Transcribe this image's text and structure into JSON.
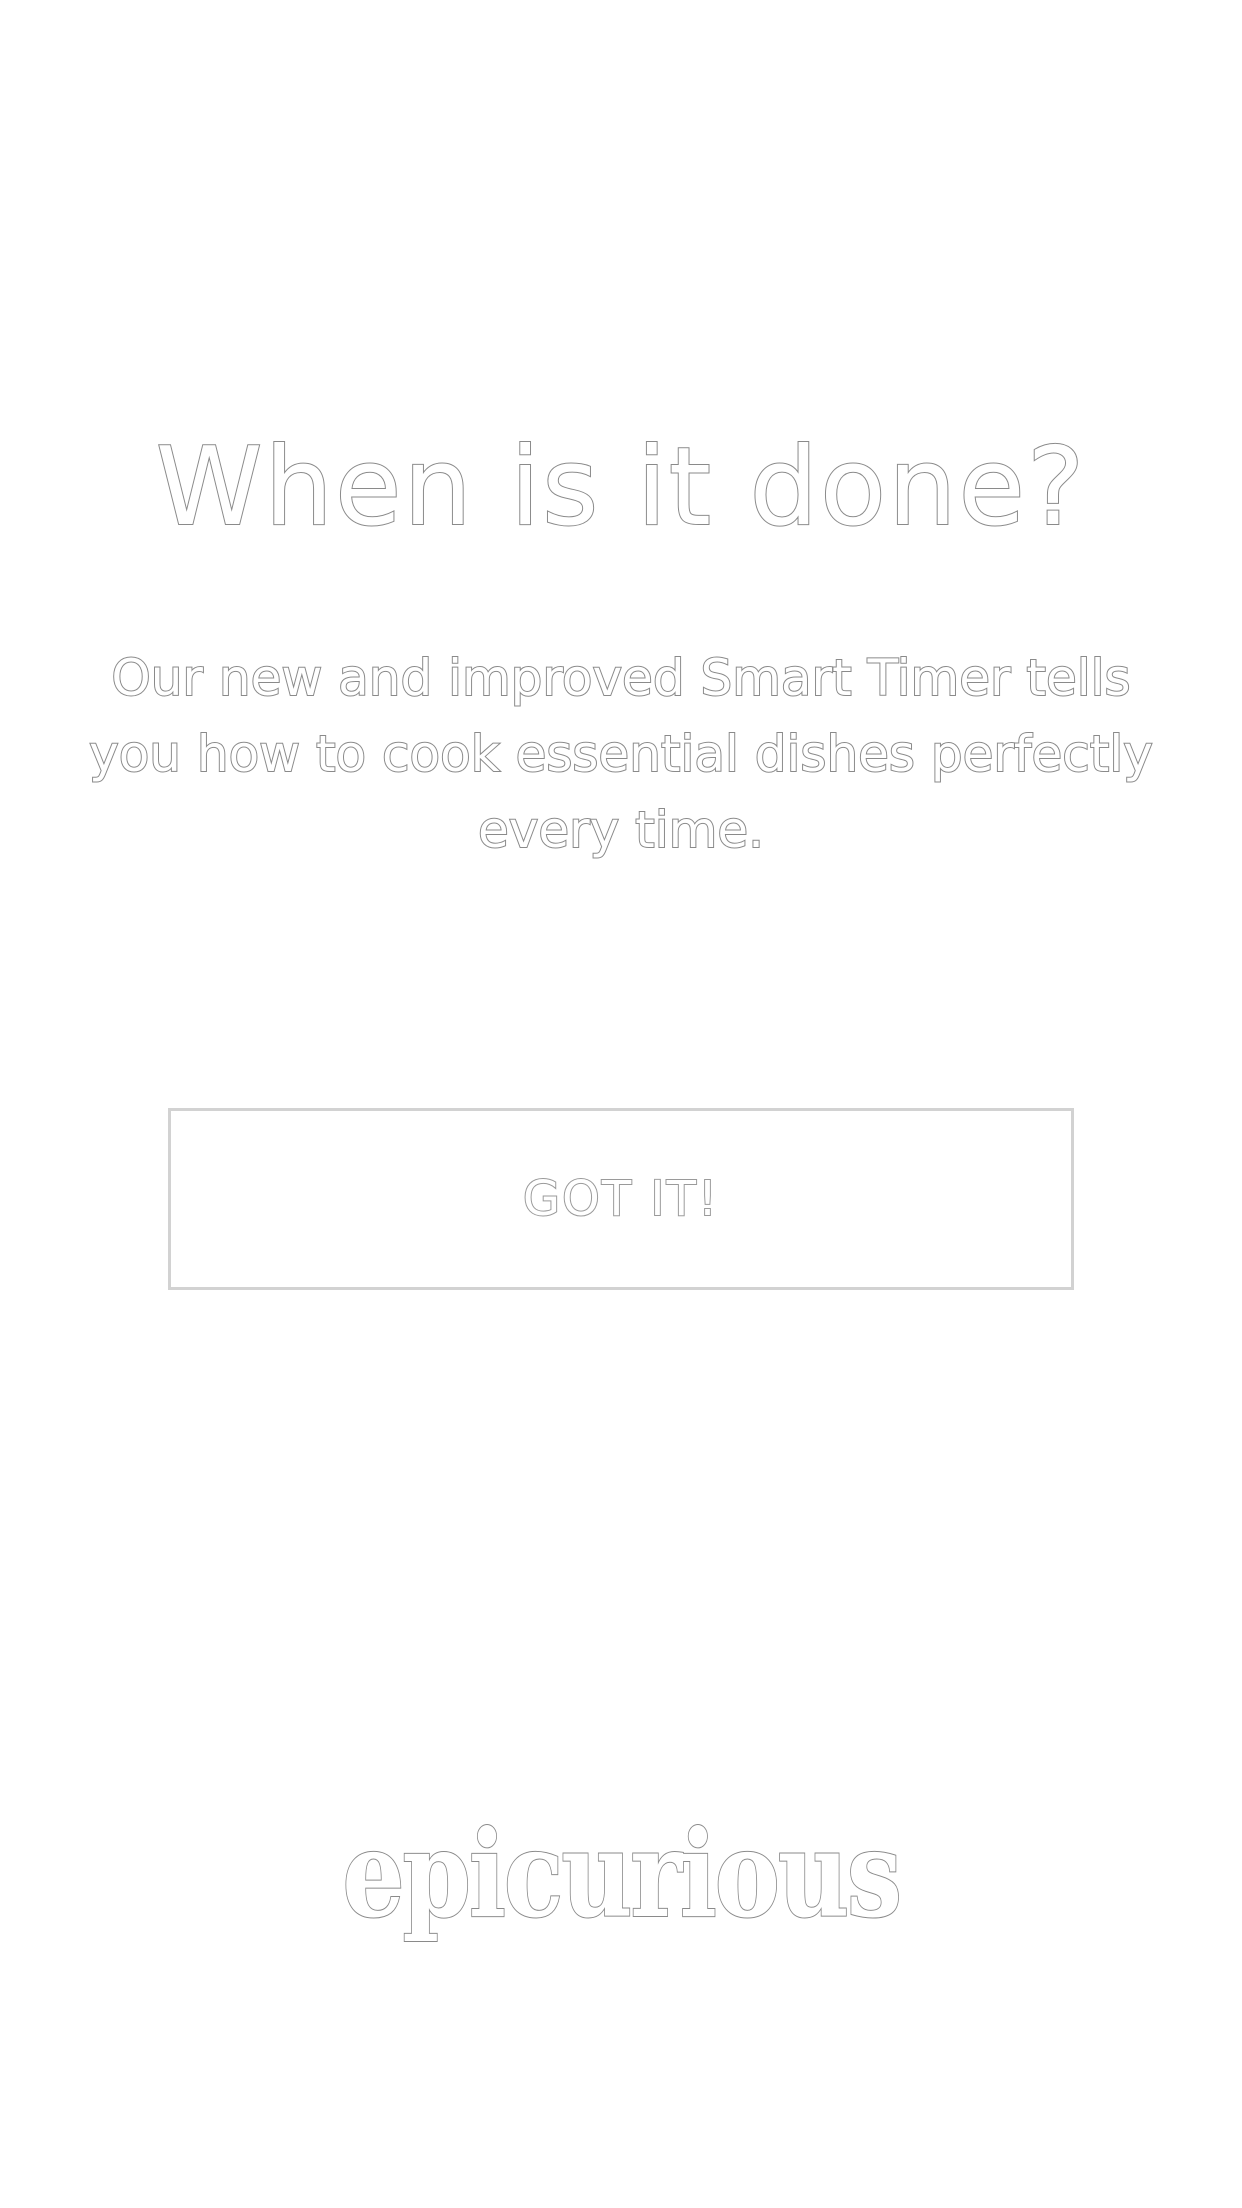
{
  "onboarding": {
    "headline": "When is it done?",
    "description": "Our new and improved Smart Timer tells you how to cook essential dishes perfectly every time.",
    "cta_label": "GOT IT!"
  },
  "brand": {
    "logo_text": "epicurious"
  },
  "colors": {
    "background": "#ffffff",
    "text_outline": "#8a8a8a",
    "button_border": "#d2d2d2"
  }
}
